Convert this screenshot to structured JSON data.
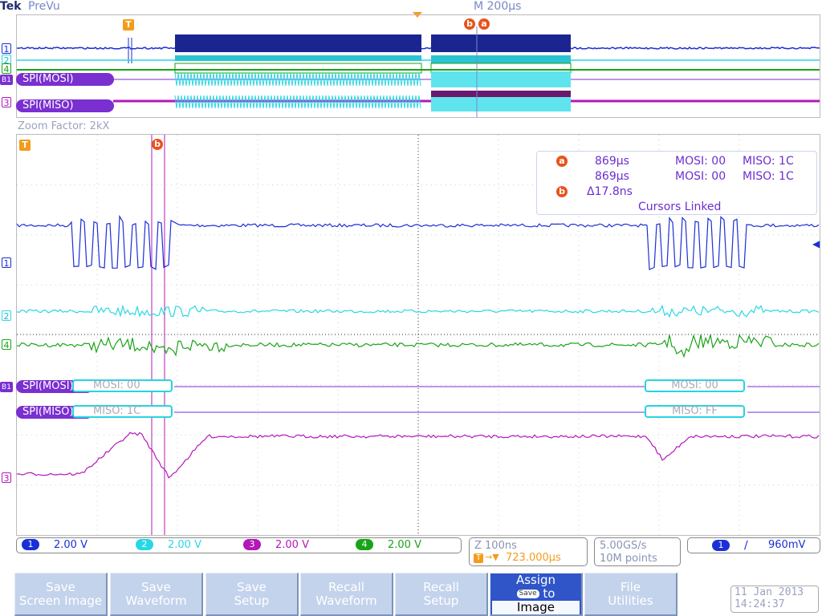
{
  "brand": "Tek",
  "mode": "PreVu",
  "timebase": "M 200µs",
  "zoom_factor": "Zoom Factor: 2kX",
  "markers": {
    "trigger": "T",
    "cursor_a": "a",
    "cursor_b": "b"
  },
  "channel_labels": {
    "ch1": "1",
    "ch2": "2",
    "ch3": "3",
    "ch4": "4",
    "bus": "B1"
  },
  "overview_buses": {
    "mosi": "SPI(MOSI)",
    "miso": "SPI(MISO)"
  },
  "zoom_buses": {
    "mosi": "SPI(MOSI)",
    "miso": "SPI(MISO)",
    "mosi_packet1": "MOSI: 00",
    "miso_packet1": "MISO: 1C",
    "mosi_packet2": "MOSI: 00",
    "miso_packet2": "MISO: FF"
  },
  "cursor_readout": {
    "a_time": "869µs",
    "a_mosi": "MOSI: 00",
    "a_miso": "MISO: 1C",
    "b_time": "869µs",
    "b_mosi": "MOSI: 00",
    "b_miso": "MISO: 1C",
    "delta": "Δ17.8ns",
    "linked": "Cursors Linked"
  },
  "vertical_scales": [
    {
      "channel": "1",
      "value": "2.00 V",
      "color": "#1b2fd6"
    },
    {
      "channel": "2",
      "value": "2.00 V",
      "color": "#29d7e4"
    },
    {
      "channel": "3",
      "value": "2.00 V",
      "color": "#b318b8"
    },
    {
      "channel": "4",
      "value": "2.00 V",
      "color": "#19a319"
    }
  ],
  "horizontal": {
    "zoom": "Z 100ns",
    "trigger_pos": "723.000µs"
  },
  "acquisition": {
    "rate": "5.00GS/s",
    "points": "10M points"
  },
  "trigger": {
    "channel": "1",
    "slope": "rising",
    "level": "960mV"
  },
  "menu": {
    "save_screen": [
      "Save",
      "Screen Image"
    ],
    "save_waveform": [
      "Save",
      "Waveform"
    ],
    "save_setup": [
      "Save",
      "Setup"
    ],
    "recall_waveform": [
      "Recall",
      "Waveform"
    ],
    "recall_setup": [
      "Recall",
      "Setup"
    ],
    "assign": [
      "Assign",
      "Save",
      "to",
      "Image"
    ],
    "file_utilities": [
      "File",
      "Utilities"
    ]
  },
  "datetime": {
    "date": "11 Jan  2013",
    "time": "14:24:37"
  },
  "colors": {
    "ch1": "#1b2fd6",
    "ch2": "#29d7e4",
    "ch3": "#b318b8",
    "ch4": "#19a319",
    "bus": "#7a2fd0",
    "cursor": "#e8521c",
    "trigger": "#f29c1c",
    "grid": "#e6e6e6"
  }
}
